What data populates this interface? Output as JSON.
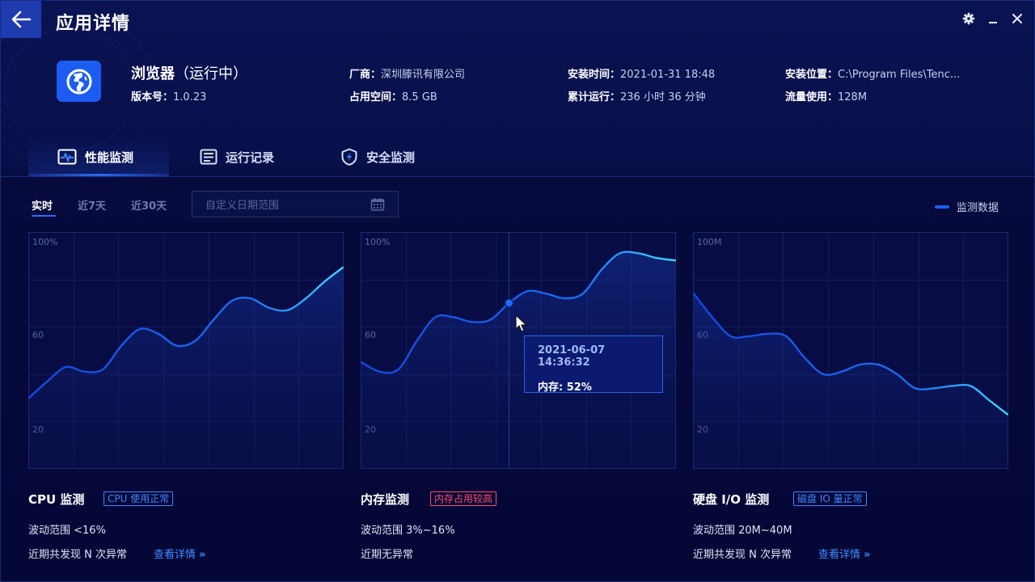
{
  "header": {
    "title": "应用详情"
  },
  "app": {
    "name": "浏览器",
    "state": "（运行中）",
    "version_label": "版本号：",
    "version": "1.0.23",
    "vendor_label": "厂商：",
    "vendor": "深圳滕讯有限公司",
    "space_label": "占用空间：",
    "space": "8.5 GB",
    "install_time_label": "安装时间：",
    "install_time": "2021-01-31 18:48",
    "runtime_label": "累计运行：",
    "runtime": "236 小时 36 分钟",
    "install_path_label": "安装位置：",
    "install_path": "C:\\Program Files\\Tenc...",
    "traffic_label": "流量使用：",
    "traffic": "128M"
  },
  "tabs": [
    {
      "label": "性能监测",
      "icon": "pulse-icon",
      "active": true
    },
    {
      "label": "运行记录",
      "icon": "log-icon",
      "active": false
    },
    {
      "label": "安全监测",
      "icon": "shield-icon",
      "active": false
    }
  ],
  "filters": {
    "ranges": [
      "实时",
      "近7天",
      "近30天"
    ],
    "date_placeholder": "自定义日期范围",
    "legend": "监测数据"
  },
  "colors": {
    "accent": "#1c5cf0",
    "line_start": "#1448e0",
    "line_end": "#3fd6ff",
    "warn": "#ff4d6a"
  },
  "chart_data": [
    {
      "type": "line",
      "name": "CPU",
      "y_ticks": [
        "100%",
        "60",
        "20"
      ],
      "x": [
        0,
        1,
        2,
        3,
        4,
        5,
        6,
        7,
        8,
        9,
        10,
        11,
        12,
        13,
        14,
        15,
        16,
        17
      ],
      "y": [
        30,
        37,
        43,
        41,
        42,
        52,
        59,
        57,
        52,
        54,
        63,
        71,
        72,
        68,
        67,
        72,
        79,
        85
      ],
      "ylim": [
        0,
        100
      ]
    },
    {
      "type": "line",
      "name": "内存",
      "y_ticks": [
        "100%",
        "60",
        "20"
      ],
      "x": [
        0,
        1,
        2,
        3,
        4,
        5,
        6,
        7,
        8,
        9,
        10,
        11,
        12,
        13,
        14,
        15,
        16,
        17
      ],
      "y": [
        45,
        41,
        42,
        54,
        64,
        64,
        62,
        63,
        70,
        75,
        74,
        72,
        74,
        84,
        91,
        91,
        89,
        88
      ],
      "ylim": [
        0,
        100
      ],
      "tooltip": {
        "time": "2021-06-07 14:36:32",
        "label": "内存: 52%",
        "index": 8
      }
    },
    {
      "type": "line",
      "name": "硬盘 I/O",
      "y_ticks": [
        "100M",
        "60",
        "20"
      ],
      "x": [
        0,
        1,
        2,
        3,
        4,
        5,
        6,
        7,
        8,
        9,
        10,
        11,
        12,
        13,
        14,
        15,
        16,
        17
      ],
      "y": [
        74,
        64,
        56,
        56,
        57,
        56,
        47,
        40,
        41,
        44,
        44,
        40,
        34,
        34,
        35,
        35,
        29,
        23
      ],
      "ylim": [
        0,
        100
      ]
    }
  ],
  "stats": [
    {
      "title": "CPU 监测",
      "badge": "CPU 使用正常",
      "badge_type": "ok",
      "range": "波动范围 <16%",
      "anomaly": "近期共发现 N 次异常",
      "link": "查看详情"
    },
    {
      "title": "内存监测",
      "badge": "内存占用较高",
      "badge_type": "warn",
      "range": "波动范围 3%~16%",
      "anomaly": "近期无异常",
      "link": ""
    },
    {
      "title": "硬盘 I/O 监测",
      "badge": "磁盘 IO 量正常",
      "badge_type": "ok",
      "range": "波动范围 20M~40M",
      "anomaly": "近期共发现 N 次异常",
      "link": "查看详情"
    }
  ]
}
